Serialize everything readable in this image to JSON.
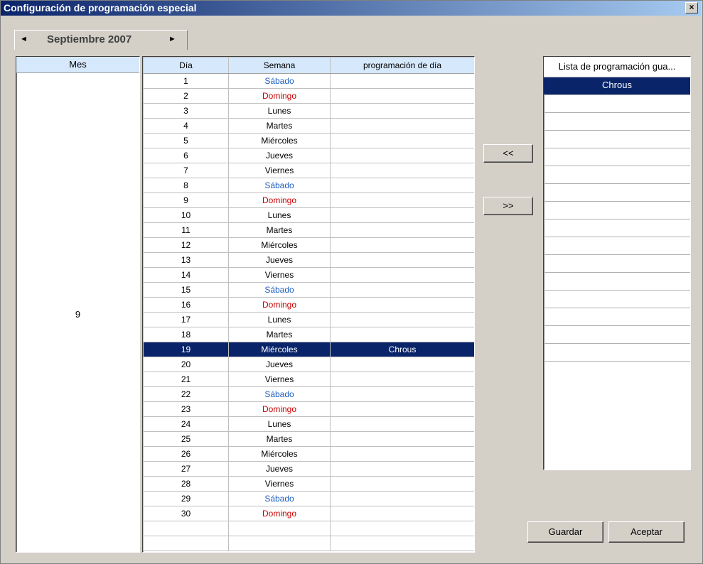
{
  "window": {
    "title": "Configuración de programación especial",
    "close_label": "×"
  },
  "month_nav": {
    "prev_arrow": "◄",
    "label": "Septiembre 2007",
    "next_arrow": "►"
  },
  "month_panel": {
    "header": "Mes",
    "value": "9"
  },
  "table": {
    "headers": [
      "Día",
      "Semana",
      "programación de día"
    ],
    "rows": [
      {
        "day": "1",
        "weekday": "Sábado",
        "schedule": ""
      },
      {
        "day": "2",
        "weekday": "Domingo",
        "schedule": ""
      },
      {
        "day": "3",
        "weekday": "Lunes",
        "schedule": ""
      },
      {
        "day": "4",
        "weekday": "Martes",
        "schedule": ""
      },
      {
        "day": "5",
        "weekday": "Miércoles",
        "schedule": ""
      },
      {
        "day": "6",
        "weekday": "Jueves",
        "schedule": ""
      },
      {
        "day": "7",
        "weekday": "Viernes",
        "schedule": ""
      },
      {
        "day": "8",
        "weekday": "Sábado",
        "schedule": ""
      },
      {
        "day": "9",
        "weekday": "Domingo",
        "schedule": ""
      },
      {
        "day": "10",
        "weekday": "Lunes",
        "schedule": ""
      },
      {
        "day": "11",
        "weekday": "Martes",
        "schedule": ""
      },
      {
        "day": "12",
        "weekday": "Miércoles",
        "schedule": ""
      },
      {
        "day": "13",
        "weekday": "Jueves",
        "schedule": ""
      },
      {
        "day": "14",
        "weekday": "Viernes",
        "schedule": ""
      },
      {
        "day": "15",
        "weekday": "Sábado",
        "schedule": ""
      },
      {
        "day": "16",
        "weekday": "Domingo",
        "schedule": ""
      },
      {
        "day": "17",
        "weekday": "Lunes",
        "schedule": ""
      },
      {
        "day": "18",
        "weekday": "Martes",
        "schedule": ""
      },
      {
        "day": "19",
        "weekday": "Miércoles",
        "schedule": "Chrous"
      },
      {
        "day": "20",
        "weekday": "Jueves",
        "schedule": ""
      },
      {
        "day": "21",
        "weekday": "Viernes",
        "schedule": ""
      },
      {
        "day": "22",
        "weekday": "Sábado",
        "schedule": ""
      },
      {
        "day": "23",
        "weekday": "Domingo",
        "schedule": ""
      },
      {
        "day": "24",
        "weekday": "Lunes",
        "schedule": ""
      },
      {
        "day": "25",
        "weekday": "Martes",
        "schedule": ""
      },
      {
        "day": "26",
        "weekday": "Miércoles",
        "schedule": ""
      },
      {
        "day": "27",
        "weekday": "Jueves",
        "schedule": ""
      },
      {
        "day": "28",
        "weekday": "Viernes",
        "schedule": ""
      },
      {
        "day": "29",
        "weekday": "Sábado",
        "schedule": ""
      },
      {
        "day": "30",
        "weekday": "Domingo",
        "schedule": ""
      }
    ],
    "selected_day": "19"
  },
  "buttons": {
    "assign": "<<",
    "remove": ">>",
    "save": "Guardar",
    "accept": "Aceptar"
  },
  "saved_list": {
    "header": "Lista de programación gua...",
    "items": [
      "Chrous"
    ]
  },
  "colors": {
    "saturday": "#1f5fbf",
    "sunday": "#cc0000",
    "selection": "#0a246a",
    "header": "#d6e8fb"
  }
}
